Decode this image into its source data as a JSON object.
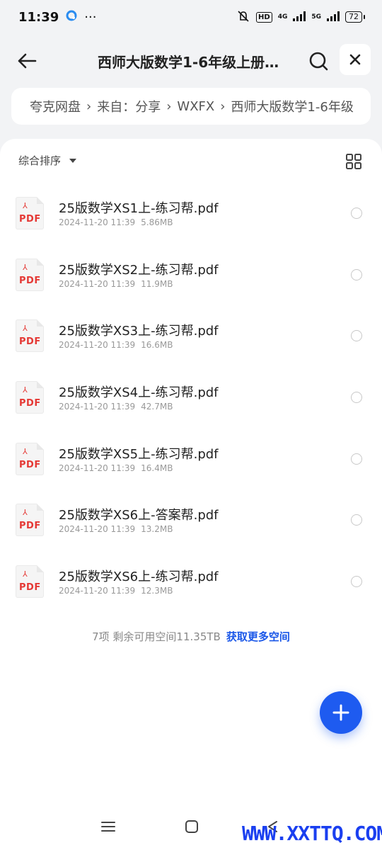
{
  "status_bar": {
    "time": "11:39",
    "dots": "···",
    "hd_label": "HD",
    "net_4g": "4G",
    "net_5g": "5G",
    "battery": "72"
  },
  "header": {
    "title": "西师大版数学1-6年级上册…"
  },
  "breadcrumb": {
    "items": [
      "夸克网盘",
      "来自：分享",
      "WXFX",
      "西师大版数学1-6年级"
    ]
  },
  "toolbar": {
    "sort_label": "综合排序"
  },
  "files": [
    {
      "name": "25版数学XS1上-练习帮.pdf",
      "date": "2024-11-20 11:39",
      "size": "5.86MB"
    },
    {
      "name": "25版数学XS2上-练习帮.pdf",
      "date": "2024-11-20 11:39",
      "size": "11.9MB"
    },
    {
      "name": "25版数学XS3上-练习帮.pdf",
      "date": "2024-11-20 11:39",
      "size": "16.6MB"
    },
    {
      "name": "25版数学XS4上-练习帮.pdf",
      "date": "2024-11-20 11:39",
      "size": "42.7MB"
    },
    {
      "name": "25版数学XS5上-练习帮.pdf",
      "date": "2024-11-20 11:39",
      "size": "16.4MB"
    },
    {
      "name": "25版数学XS6上-答案帮.pdf",
      "date": "2024-11-20 11:39",
      "size": "13.2MB"
    },
    {
      "name": "25版数学XS6上-练习帮.pdf",
      "date": "2024-11-20 11:39",
      "size": "12.3MB"
    }
  ],
  "pdf_icon_label": "PDF",
  "footer": {
    "summary": "7项 剩余可用空间11.35TB",
    "link": "获取更多空间"
  },
  "watermark": "WWW.XXTTQ.COM",
  "colors": {
    "accent": "#1e5bf0",
    "link": "#1a57e8",
    "pdf_red": "#e53935",
    "background": "#f2f3f5"
  },
  "icons": {
    "back": "arrow-left-icon",
    "search": "search-icon",
    "close": "close-icon",
    "grid": "grid-view-icon",
    "add": "plus-icon"
  }
}
